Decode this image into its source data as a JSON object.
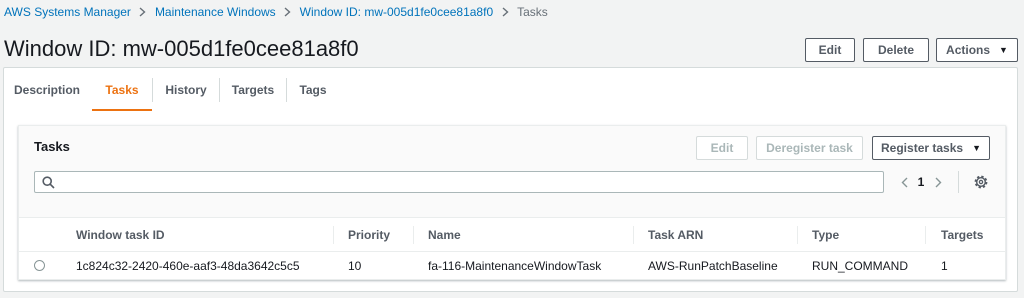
{
  "breadcrumb": {
    "items": [
      {
        "label": "AWS Systems Manager"
      },
      {
        "label": "Maintenance Windows"
      },
      {
        "label": "Window ID: mw-005d1fe0cee81a8f0"
      }
    ],
    "current": "Tasks"
  },
  "page": {
    "title": "Window ID: mw-005d1fe0cee81a8f0"
  },
  "header_actions": {
    "edit": "Edit",
    "delete": "Delete",
    "actions": "Actions"
  },
  "tabs": [
    {
      "label": "Description"
    },
    {
      "label": "Tasks",
      "active": true
    },
    {
      "label": "History"
    },
    {
      "label": "Targets"
    },
    {
      "label": "Tags"
    }
  ],
  "tasks_panel": {
    "title": "Tasks",
    "edit_label": "Edit",
    "deregister_label": "Deregister task",
    "register_label": "Register tasks",
    "search_value": "",
    "current_page": "1",
    "columns": {
      "window_task_id": "Window task ID",
      "priority": "Priority",
      "name": "Name",
      "task_arn": "Task ARN",
      "type": "Type",
      "targets": "Targets"
    },
    "rows": [
      {
        "window_task_id": "1c824c32-2420-460e-aaf3-48da3642c5c5",
        "priority": "10",
        "name": "fa-116-MaintenanceWindowTask",
        "task_arn": "AWS-RunPatchBaseline",
        "type": "RUN_COMMAND",
        "targets": "1"
      }
    ]
  },
  "colors": {
    "link": "#0073bb",
    "active_tab": "#ec7211",
    "text": "#16191f",
    "muted": "#545b64",
    "border": "#d5dbdb"
  }
}
